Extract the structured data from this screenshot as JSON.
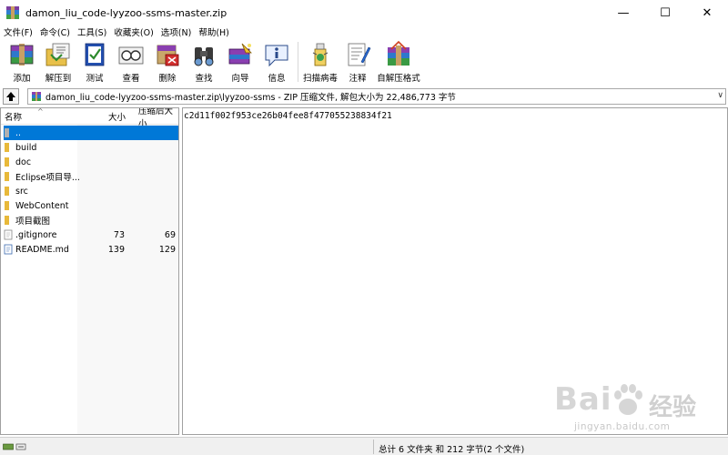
{
  "window": {
    "title": "damon_liu_code-lyyzoo-ssms-master.zip",
    "minimize_glyph": "—",
    "maximize_glyph": "☐",
    "close_glyph": "✕"
  },
  "menu": [
    "文件(F)",
    "命令(C)",
    "工具(S)",
    "收藏夹(O)",
    "选项(N)",
    "帮助(H)"
  ],
  "toolbar": [
    {
      "label": "添加",
      "icon": "add-archive-icon"
    },
    {
      "label": "解压到",
      "icon": "extract-to-icon"
    },
    {
      "label": "测试",
      "icon": "test-icon"
    },
    {
      "label": "查看",
      "icon": "view-icon"
    },
    {
      "label": "删除",
      "icon": "delete-icon"
    },
    {
      "label": "查找",
      "icon": "find-icon"
    },
    {
      "label": "向导",
      "icon": "wizard-icon"
    },
    {
      "label": "信息",
      "icon": "info-icon"
    },
    {
      "label": "扫描病毒",
      "icon": "virus-scan-icon"
    },
    {
      "label": "注释",
      "icon": "comment-icon"
    },
    {
      "label": "自解压格式",
      "icon": "sfx-icon"
    }
  ],
  "pathbar": {
    "path": "damon_liu_code-lyyzoo-ssms-master.zip\\lyyzoo-ssms - ZIP 压缩文件, 解包大小为 22,486,773 字节"
  },
  "filelist": {
    "headers": {
      "name": "名称",
      "size": "大小",
      "packed": "压缩后大小"
    },
    "sort_indicator": "^",
    "rows": [
      {
        "name": "..",
        "size": "",
        "packed": "",
        "type": "parent",
        "selected": true
      },
      {
        "name": "build",
        "size": "",
        "packed": "",
        "type": "folder"
      },
      {
        "name": "doc",
        "size": "",
        "packed": "",
        "type": "folder"
      },
      {
        "name": "Eclipse项目导...",
        "size": "",
        "packed": "",
        "type": "folder"
      },
      {
        "name": "src",
        "size": "",
        "packed": "",
        "type": "folder"
      },
      {
        "name": "WebContent",
        "size": "",
        "packed": "",
        "type": "folder"
      },
      {
        "name": "项目截图",
        "size": "",
        "packed": "",
        "type": "folder"
      },
      {
        "name": ".gitignore",
        "size": "73",
        "packed": "69",
        "type": "file"
      },
      {
        "name": "README.md",
        "size": "139",
        "packed": "129",
        "type": "file"
      }
    ]
  },
  "viewer": {
    "comment": "c2d11f002f953ce26b04fee8f477055238834f21"
  },
  "watermark": {
    "logo": "Bai",
    "logo_tail": "经验",
    "url": "jingyan.baidu.com"
  },
  "status": {
    "text": "总计 6 文件夹 和 212 字节(2 个文件)"
  },
  "colors": {
    "selection": "#0078d7",
    "folder": "#e8b93a"
  }
}
